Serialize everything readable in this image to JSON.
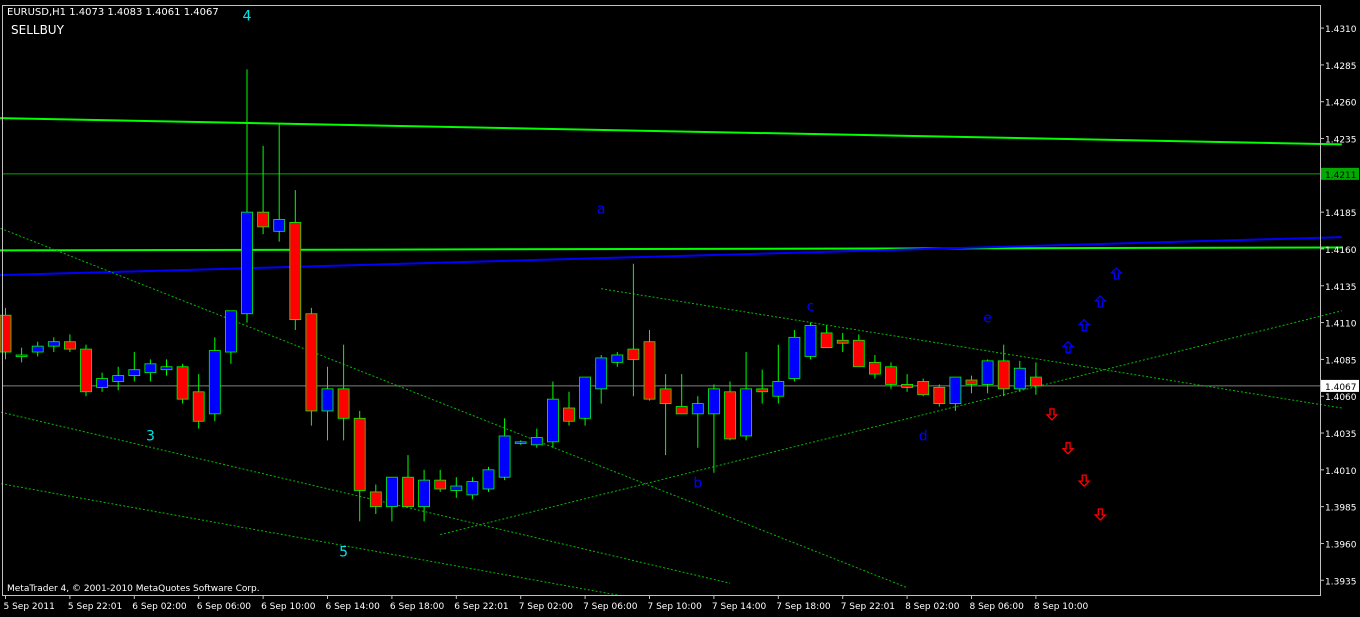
{
  "header": {
    "symbol_line": "EURUSD,H1  1.4073 1.4083 1.4061 1.4067",
    "indicator_label": "SELLBUY"
  },
  "footer": {
    "copyright": "MetaTrader 4, © 2001-2010 MetaQuotes Software Corp."
  },
  "colors": {
    "background": "#000000",
    "frame": "#c0c0c0",
    "bull_body": "#0000ff",
    "bear_body": "#ff0000",
    "wick": "#00ff00",
    "trend_green": "#00ff00",
    "trend_blue": "#0000ff",
    "level_dark_green": "#00aa00",
    "channel_dotted": "#00bb00",
    "wave_cyan": "#00e5e5",
    "wave_blue": "#0000ff",
    "arrow_up": "#0000ff",
    "arrow_down": "#ff0000",
    "current_price_line": "#808080"
  },
  "chart_data": {
    "type": "candlestick",
    "symbol": "EURUSD",
    "timeframe": "H1",
    "last_bar": {
      "open": 1.4073,
      "high": 1.4083,
      "low": 1.4061,
      "close": 1.4067
    },
    "ylim": [
      1.3925,
      1.4325
    ],
    "y_ticks": [
      "1.4310",
      "1.4285",
      "1.4260",
      "1.4235",
      "1.4210",
      "1.4185",
      "1.4160",
      "1.4135",
      "1.4110",
      "1.4085",
      "1.4060",
      "1.4035",
      "1.4010",
      "1.3985",
      "1.3960",
      "1.3935"
    ],
    "current_price_label": "1.4067",
    "level_price_label": "1.4211",
    "x_ticks": [
      {
        "i": 0,
        "label": "5 Sep 2011"
      },
      {
        "i": 4,
        "label": "5 Sep 22:01"
      },
      {
        "i": 8,
        "label": "6 Sep 02:00"
      },
      {
        "i": 12,
        "label": "6 Sep 06:00"
      },
      {
        "i": 16,
        "label": "6 Sep 10:00"
      },
      {
        "i": 20,
        "label": "6 Sep 14:00"
      },
      {
        "i": 24,
        "label": "6 Sep 18:00"
      },
      {
        "i": 28,
        "label": "6 Sep 22:01"
      },
      {
        "i": 32,
        "label": "7 Sep 02:00"
      },
      {
        "i": 36,
        "label": "7 Sep 06:00"
      },
      {
        "i": 40,
        "label": "7 Sep 10:00"
      },
      {
        "i": 44,
        "label": "7 Sep 14:00"
      },
      {
        "i": 48,
        "label": "7 Sep 18:00"
      },
      {
        "i": 52,
        "label": "7 Sep 22:01"
      },
      {
        "i": 56,
        "label": "8 Sep 02:00"
      },
      {
        "i": 60,
        "label": "8 Sep 06:00"
      },
      {
        "i": 64,
        "label": "8 Sep 10:00"
      }
    ],
    "candles": [
      [
        1.4115,
        1.412,
        1.4085,
        1.409
      ],
      [
        1.4088,
        1.4093,
        1.4083,
        1.4088
      ],
      [
        1.409,
        1.4097,
        1.4087,
        1.4094
      ],
      [
        1.4094,
        1.41,
        1.409,
        1.4097
      ],
      [
        1.4097,
        1.4102,
        1.409,
        1.4092
      ],
      [
        1.4092,
        1.4095,
        1.406,
        1.4063
      ],
      [
        1.4066,
        1.4076,
        1.4063,
        1.4072
      ],
      [
        1.407,
        1.408,
        1.4064,
        1.4074
      ],
      [
        1.4074,
        1.409,
        1.407,
        1.4078
      ],
      [
        1.4076,
        1.4085,
        1.407,
        1.4082
      ],
      [
        1.4078,
        1.4085,
        1.4074,
        1.408
      ],
      [
        1.408,
        1.4082,
        1.4055,
        1.4058
      ],
      [
        1.4063,
        1.4075,
        1.4038,
        1.4043
      ],
      [
        1.4048,
        1.41,
        1.4043,
        1.4091
      ],
      [
        1.409,
        1.4118,
        1.4082,
        1.4118
      ],
      [
        1.4116,
        1.4282,
        1.411,
        1.4185
      ],
      [
        1.4185,
        1.423,
        1.417,
        1.4175
      ],
      [
        1.4172,
        1.4245,
        1.4165,
        1.418
      ],
      [
        1.4178,
        1.42,
        1.4105,
        1.4112
      ],
      [
        1.4116,
        1.412,
        1.404,
        1.405
      ],
      [
        1.405,
        1.408,
        1.403,
        1.4065
      ],
      [
        1.4065,
        1.4095,
        1.403,
        1.4045
      ],
      [
        1.4045,
        1.405,
        1.3975,
        1.3996
      ],
      [
        1.3995,
        1.4,
        1.398,
        1.3985
      ],
      [
        1.3985,
        1.4005,
        1.3975,
        1.4005
      ],
      [
        1.4005,
        1.402,
        1.3985,
        1.3985
      ],
      [
        1.3985,
        1.401,
        1.3975,
        1.4003
      ],
      [
        1.4003,
        1.401,
        1.3995,
        1.3997
      ],
      [
        1.3996,
        1.4005,
        1.3991,
        1.3999
      ],
      [
        1.3993,
        1.4005,
        1.399,
        1.4002
      ],
      [
        1.3997,
        1.4012,
        1.3995,
        1.401
      ],
      [
        1.4005,
        1.4045,
        1.4003,
        1.4033
      ],
      [
        1.4029,
        1.403,
        1.4027,
        1.4029
      ],
      [
        1.4027,
        1.4038,
        1.4025,
        1.4032
      ],
      [
        1.4029,
        1.407,
        1.4025,
        1.4058
      ],
      [
        1.4052,
        1.4063,
        1.404,
        1.4043
      ],
      [
        1.4045,
        1.4072,
        1.404,
        1.4073
      ],
      [
        1.4065,
        1.4088,
        1.4055,
        1.4086
      ],
      [
        1.4083,
        1.409,
        1.408,
        1.4088
      ],
      [
        1.4092,
        1.415,
        1.406,
        1.4085
      ],
      [
        1.4097,
        1.4105,
        1.4057,
        1.4058
      ],
      [
        1.4065,
        1.4075,
        1.402,
        1.4055
      ],
      [
        1.4053,
        1.4075,
        1.405,
        1.4048
      ],
      [
        1.4048,
        1.406,
        1.4025,
        1.4055
      ],
      [
        1.4048,
        1.4068,
        1.4008,
        1.4065
      ],
      [
        1.4063,
        1.407,
        1.403,
        1.4031
      ],
      [
        1.4033,
        1.409,
        1.403,
        1.4065
      ],
      [
        1.4065,
        1.4078,
        1.4055,
        1.4063
      ],
      [
        1.406,
        1.4095,
        1.4055,
        1.407
      ],
      [
        1.4072,
        1.4105,
        1.407,
        1.41
      ],
      [
        1.4087,
        1.411,
        1.4085,
        1.4108
      ],
      [
        1.4103,
        1.4108,
        1.4093,
        1.4093
      ],
      [
        1.4098,
        1.4103,
        1.409,
        1.4096
      ],
      [
        1.4098,
        1.4102,
        1.408,
        1.408
      ],
      [
        1.4083,
        1.4088,
        1.4072,
        1.4075
      ],
      [
        1.408,
        1.4083,
        1.4065,
        1.4068
      ],
      [
        1.4068,
        1.4075,
        1.4063,
        1.4066
      ],
      [
        1.407,
        1.4072,
        1.406,
        1.4061
      ],
      [
        1.4066,
        1.4068,
        1.4053,
        1.4055
      ],
      [
        1.4055,
        1.4073,
        1.405,
        1.4073
      ],
      [
        1.4071,
        1.4074,
        1.4062,
        1.4068
      ],
      [
        1.4068,
        1.4085,
        1.4062,
        1.4084
      ],
      [
        1.4084,
        1.4095,
        1.406,
        1.4065
      ],
      [
        1.4065,
        1.4084,
        1.4063,
        1.4079
      ],
      [
        1.4073,
        1.4083,
        1.4061,
        1.4067
      ]
    ],
    "lines": [
      {
        "kind": "trend",
        "color": "trend_green",
        "width": 2,
        "p1": [
          -1,
          1.4249
        ],
        "p2": [
          83,
          1.4231
        ]
      },
      {
        "kind": "trend",
        "color": "trend_green",
        "width": 2,
        "p1": [
          -1,
          1.4159
        ],
        "p2": [
          83,
          1.4161
        ]
      },
      {
        "kind": "trend",
        "color": "trend_blue",
        "width": 2,
        "p1": [
          -1,
          1.4142
        ],
        "p2": [
          83,
          1.4168
        ]
      },
      {
        "kind": "hline",
        "color": "level_dark_green",
        "width": 1,
        "price": 1.4211
      },
      {
        "kind": "hline",
        "color": "current_price_line",
        "width": 1,
        "price": 1.4067
      },
      {
        "kind": "trend",
        "color": "channel_dotted",
        "dashed": true,
        "p1": [
          -1,
          1.4177
        ],
        "p2": [
          56,
          1.393
        ]
      },
      {
        "kind": "trend",
        "color": "channel_dotted",
        "dashed": true,
        "p1": [
          -1,
          1.4051
        ],
        "p2": [
          45,
          1.3933
        ]
      },
      {
        "kind": "trend",
        "color": "channel_dotted",
        "dashed": true,
        "p1": [
          -1,
          1.4002
        ],
        "p2": [
          38,
          1.3925
        ]
      },
      {
        "kind": "trend",
        "color": "channel_dotted",
        "dashed": true,
        "p1": [
          27,
          1.3966
        ],
        "p2": [
          83,
          1.4118
        ]
      },
      {
        "kind": "trend",
        "color": "channel_dotted",
        "dashed": true,
        "p1": [
          37,
          1.4133
        ],
        "p2": [
          83,
          1.4052
        ]
      }
    ],
    "wave_labels": [
      {
        "text": "4",
        "i": 15,
        "price": 1.4315,
        "color": "wave_cyan"
      },
      {
        "text": "3",
        "i": 9,
        "price": 1.403,
        "color": "wave_cyan"
      },
      {
        "text": "5",
        "i": 21,
        "price": 1.3951,
        "color": "wave_cyan"
      },
      {
        "text": "a",
        "i": 37,
        "price": 1.4184,
        "color": "wave_blue"
      },
      {
        "text": "b",
        "i": 43,
        "price": 1.3998,
        "color": "wave_blue"
      },
      {
        "text": "c",
        "i": 50,
        "price": 1.4118,
        "color": "wave_blue"
      },
      {
        "text": "d",
        "i": 57,
        "price": 1.403,
        "color": "wave_blue"
      },
      {
        "text": "e",
        "i": 61,
        "price": 1.411,
        "color": "wave_blue"
      }
    ],
    "arrows_up": [
      {
        "i": 66,
        "price": 1.4093
      },
      {
        "i": 67,
        "price": 1.4108
      },
      {
        "i": 68,
        "price": 1.4124
      },
      {
        "i": 69,
        "price": 1.4143
      }
    ],
    "arrows_down": [
      {
        "i": 65,
        "price": 1.4048
      },
      {
        "i": 66,
        "price": 1.4025
      },
      {
        "i": 67,
        "price": 1.4003
      },
      {
        "i": 68,
        "price": 1.398
      }
    ]
  }
}
